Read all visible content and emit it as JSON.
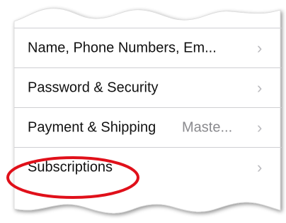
{
  "settings": {
    "items": [
      {
        "label": "Name, Phone Numbers, Em...",
        "detail": "",
        "chevron": "›"
      },
      {
        "label": "Password & Security",
        "detail": "",
        "chevron": "›"
      },
      {
        "label": "Payment & Shipping",
        "detail": "Maste...",
        "chevron": "›"
      },
      {
        "label": "Subscriptions",
        "detail": "",
        "chevron": "›"
      }
    ]
  },
  "colors": {
    "annotation_circle": "#e0101a",
    "separator": "#cfcfd3",
    "chevron": "#b9b9bd",
    "detail_text": "#8a8a8e"
  }
}
